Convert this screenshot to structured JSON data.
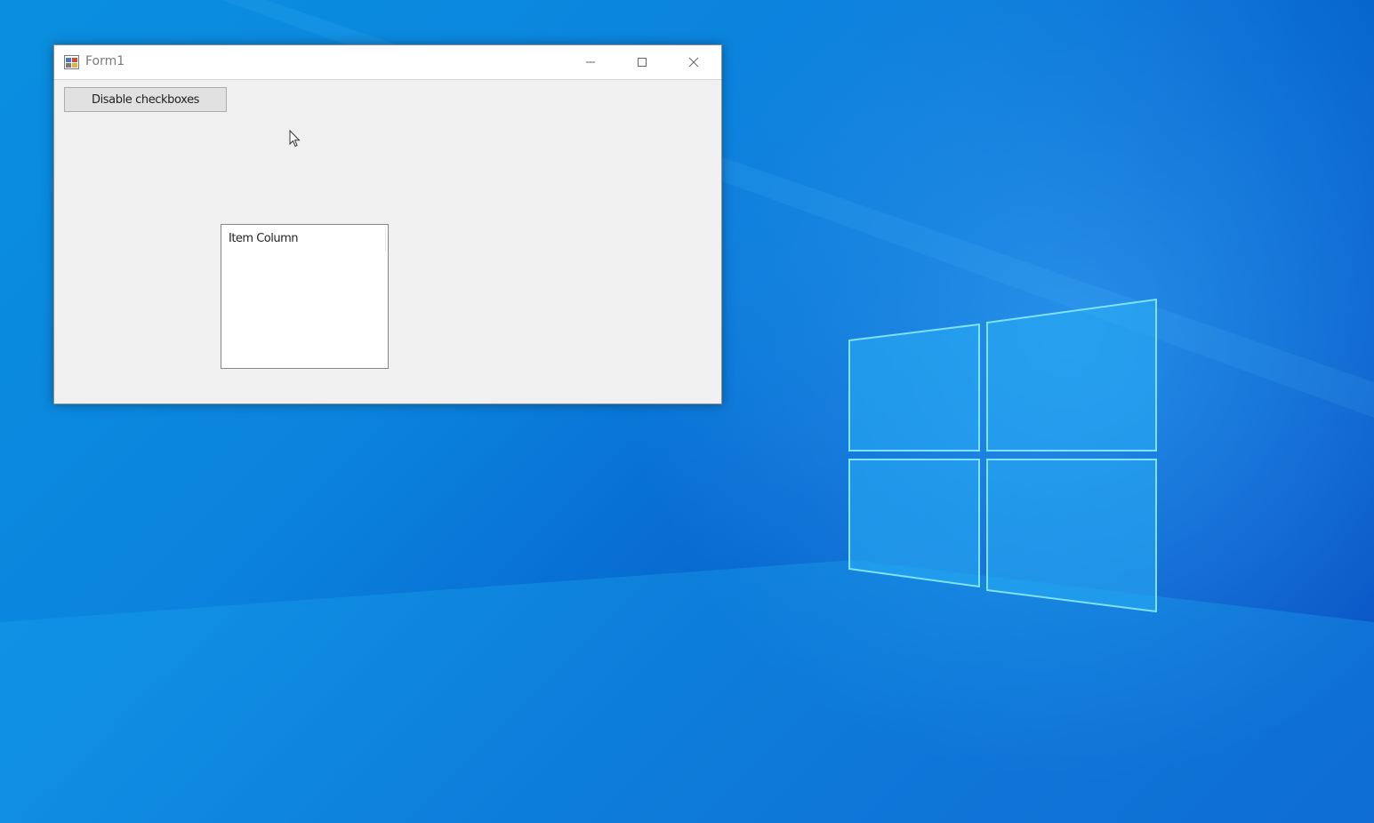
{
  "window": {
    "title": "Form1"
  },
  "toolbar": {
    "disable_button_label": "Disable checkboxes"
  },
  "listview": {
    "columns": [
      {
        "header": "Item Column"
      }
    ]
  },
  "colors": {
    "desktop_blue": "#0a8fe0",
    "window_bg": "#f0f0f0",
    "button_bg": "#e1e1e1"
  }
}
